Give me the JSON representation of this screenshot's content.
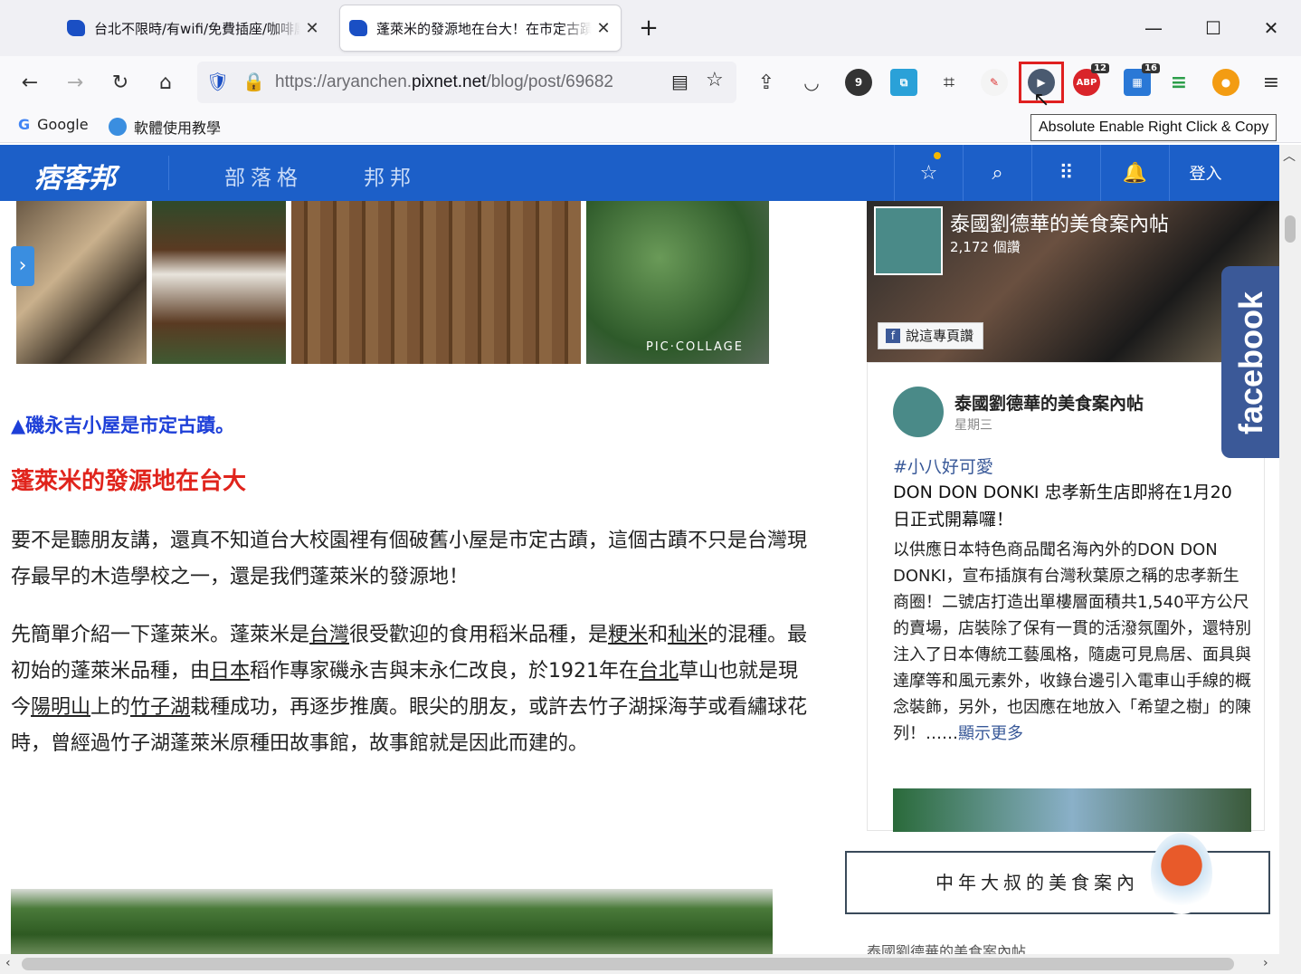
{
  "browser": {
    "tabs": [
      {
        "title": "台北不限時/有wifi/免費插座/咖啡廳"
      },
      {
        "title": "蓬萊米的發源地在台大！在市定古蹟"
      }
    ],
    "new_tab_glyph": "+",
    "url": {
      "prefix": "https://aryanchen.",
      "domain": "pixnet.net",
      "path": "/blog/post/69682"
    },
    "bookmarks": [
      {
        "label": "Google",
        "icon": "google-icon"
      },
      {
        "label": "軟體使用教學",
        "icon": "folder-icon"
      }
    ],
    "tooltip": "Absolute Enable Right Click & Copy",
    "extension_badges": {
      "abp": "12",
      "calendar": "16"
    },
    "highlight_color": "#e02020"
  },
  "site": {
    "logo": "痞客邦",
    "nav": [
      "部落格",
      "邦邦"
    ],
    "login": "登入",
    "brand_color": "#1c5fc8"
  },
  "article": {
    "photo_watermark": "PIC·COLLAGE",
    "caption": "▲磯永吉小屋是市定古蹟。",
    "heading": "蓬萊米的發源地在台大",
    "paragraph1": "要不是聽朋友講，還真不知道台大校園裡有個破舊小屋是市定古蹟，這個古蹟不只是台灣現存最早的木造學校之一，還是我們蓬萊米的發源地！",
    "paragraph2_segments": [
      {
        "text": "先簡單介紹一下蓬萊米。蓬萊米是",
        "link": false
      },
      {
        "text": "台灣",
        "link": true
      },
      {
        "text": "很受歡迎的食用稻米品種，是",
        "link": false
      },
      {
        "text": "粳米",
        "link": true
      },
      {
        "text": "和",
        "link": false
      },
      {
        "text": "秈米",
        "link": true
      },
      {
        "text": "的混種。最初始的蓬萊米品種，由",
        "link": false
      },
      {
        "text": "日本",
        "link": true
      },
      {
        "text": "稻作專家磯永吉與末永仁改良，於1921年在",
        "link": false
      },
      {
        "text": "台北",
        "link": true
      },
      {
        "text": "草山也就是現今",
        "link": false
      },
      {
        "text": "陽明山",
        "link": true
      },
      {
        "text": "上的",
        "link": false
      },
      {
        "text": "竹子湖",
        "link": true
      },
      {
        "text": "栽種成功，再逐步推廣。眼尖的朋友，或許去竹子湖採海芋或看繡球花時，曾經過竹子湖蓬萊米原種田故事館，故事館就是因此而建的。",
        "link": false
      }
    ],
    "caption_color": "#1d3fd8",
    "heading_color": "#e0241c"
  },
  "sidebar": {
    "fb_page_name": "泰國劉德華的美食案內帖",
    "fb_likes": "2,172 個讚",
    "fb_like_button": "說這專頁讚",
    "fb_tab": "facebook",
    "post": {
      "author": "泰國劉德華的美食案內帖",
      "date": "星期三",
      "hashtag": "#小八好可愛",
      "title": "DON DON DONKI 忠孝新生店即將在1月20日正式開幕囉！",
      "body": "以供應日本特色商品聞名海內外的DON DON DONKI，宣布插旗有台灣秋葉原之稱的忠孝新生商圈！二號店打造出單樓層面積共1,540平方公尺的賣場，店裝除了保有一貫的活潑氛圍外，還特別注入了日本傳統工藝風格，隨處可見鳥居、面具與達摩等和風元素外，收錄台邊引入電車山手線的概念裝飾，另外，也因應在地放入「希望之樹」的陳列！……",
      "more": "顯示更多"
    },
    "banner": "中年大叔的美食案內",
    "bottom_text": "泰國劉德華的美食案內帖",
    "fb_color": "#3b5998"
  }
}
